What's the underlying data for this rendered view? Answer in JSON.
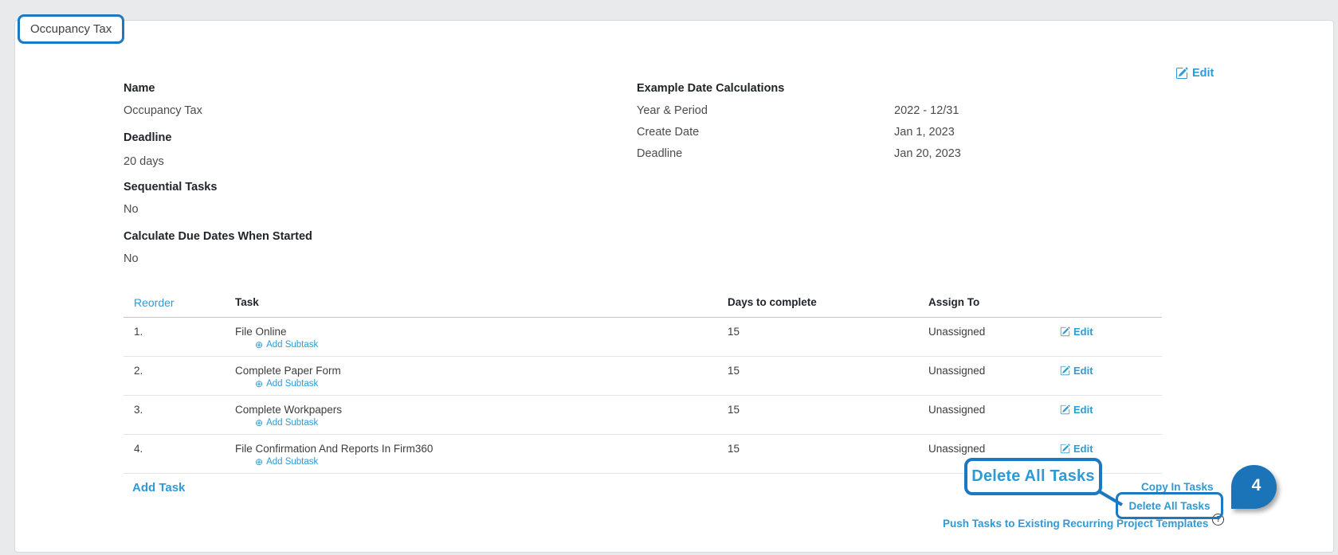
{
  "page": {
    "title_callout": "Occupancy Tax"
  },
  "header": {
    "edit_label": "Edit"
  },
  "details": {
    "left": [
      {
        "label": "Name",
        "value": "Occupancy Tax"
      },
      {
        "label": "Deadline",
        "value": "20 days"
      },
      {
        "label": "Sequential Tasks",
        "value": "No"
      },
      {
        "label": "Calculate Due Dates When Started",
        "value": "No"
      }
    ],
    "right": {
      "title": "Example Date Calculations",
      "rows": [
        {
          "label": "Year & Period",
          "value": "2022 - 12/31"
        },
        {
          "label": "Create Date",
          "value": "Jan 1, 2023"
        },
        {
          "label": "Deadline",
          "value": "Jan 20, 2023"
        }
      ]
    }
  },
  "task_table": {
    "headers": {
      "reorder": "Reorder",
      "task": "Task",
      "days": "Days to complete",
      "assign": "Assign To"
    },
    "add_subtask_icon": "⊕",
    "add_subtask_label": "Add Subtask",
    "edit_label": "Edit",
    "rows": [
      {
        "num": "1.",
        "task": "File Online",
        "days": "15",
        "assign": "Unassigned"
      },
      {
        "num": "2.",
        "task": "Complete Paper Form",
        "days": "15",
        "assign": "Unassigned"
      },
      {
        "num": "3.",
        "task": "Complete Workpapers",
        "days": "15",
        "assign": "Unassigned"
      },
      {
        "num": "4.",
        "task": "File Confirmation And Reports In Firm360",
        "days": "15",
        "assign": "Unassigned"
      }
    ]
  },
  "footer": {
    "add_task": "Add Task",
    "copy_in_tasks": "Copy In Tasks",
    "delete_all_tasks": "Delete All Tasks",
    "push_tasks": "Push Tasks to Existing Recurring Project Templates",
    "help_icon": "?"
  },
  "annotations": {
    "callout_label": "Delete All Tasks",
    "step_number": "4",
    "colors": {
      "annotation_blue": "#1c78c0",
      "link_blue": "#2e9ad6",
      "balloon_blue": "#1b73b8"
    }
  }
}
